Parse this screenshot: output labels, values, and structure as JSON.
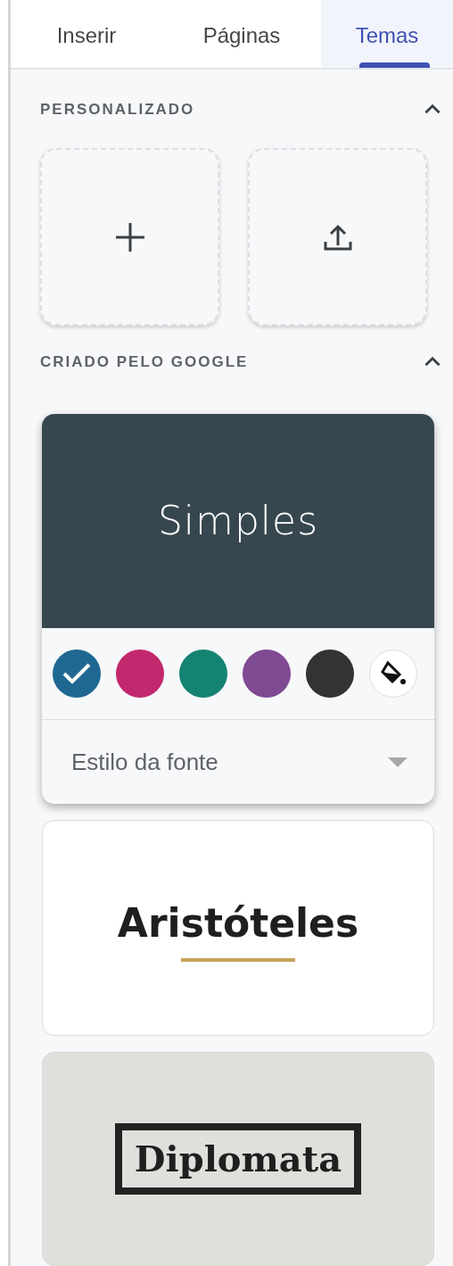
{
  "tabs": [
    {
      "label": "Inserir",
      "selected": false
    },
    {
      "label": "Páginas",
      "selected": false
    },
    {
      "label": "Temas",
      "selected": true
    }
  ],
  "custom": {
    "title": "PERSONALIZADO",
    "expanded": true,
    "tiles": [
      {
        "kind": "add"
      },
      {
        "kind": "upload"
      }
    ]
  },
  "google": {
    "title": "CRIADO PELO GOOGLE",
    "expanded": true,
    "themes": [
      {
        "kind": "simples",
        "name": "Simples",
        "swatches": [
          {
            "color": "#1f6891",
            "selected": true
          },
          {
            "color": "#c2286e",
            "selected": false
          },
          {
            "color": "#148372",
            "selected": false
          },
          {
            "color": "#804a93",
            "selected": false
          },
          {
            "color": "#333333",
            "selected": false
          }
        ],
        "font_style": "Estilo da fonte"
      },
      {
        "kind": "aristoteles",
        "name": "Aristóteles"
      },
      {
        "kind": "diplomata",
        "name": "Diplomata"
      }
    ]
  }
}
